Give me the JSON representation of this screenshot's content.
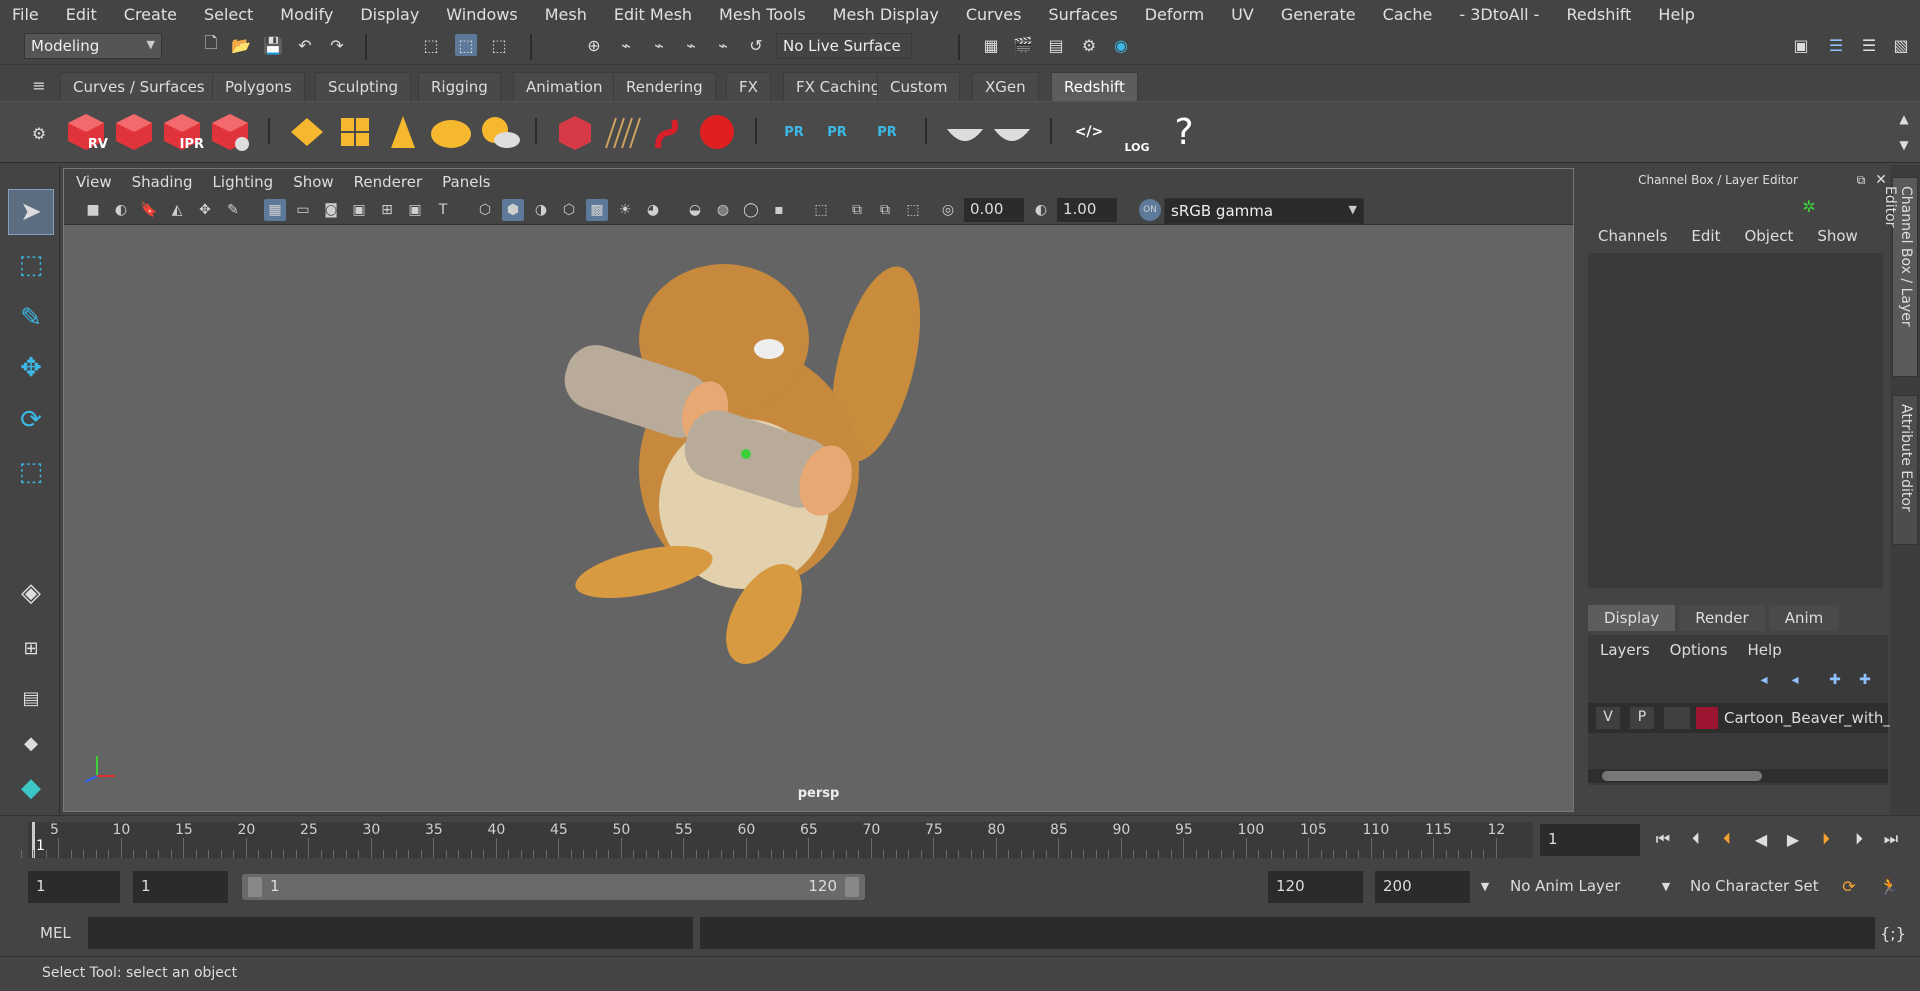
{
  "menu": [
    "File",
    "Edit",
    "Create",
    "Select",
    "Modify",
    "Display",
    "Windows",
    "Mesh",
    "Edit Mesh",
    "Mesh Tools",
    "Mesh Display",
    "Curves",
    "Surfaces",
    "Deform",
    "UV",
    "Generate",
    "Cache",
    "- 3DtoAll -",
    "Redshift",
    "Help"
  ],
  "status": {
    "workspace": "Modeling",
    "live_surface": "No Live Surface"
  },
  "shelf_tabs": [
    "Curves / Surfaces",
    "Polygons",
    "Sculpting",
    "Rigging",
    "Animation",
    "Rendering",
    "FX",
    "FX Caching",
    "Custom",
    "XGen",
    "Redshift"
  ],
  "active_shelf_tab": "Redshift",
  "shelf_labels": {
    "rv": "RV",
    "ipr": "IPR",
    "pr1": "PR",
    "pr2": "PR",
    "pr3": "PR",
    "log": "LOG"
  },
  "viewport": {
    "menu": [
      "View",
      "Shading",
      "Lighting",
      "Show",
      "Renderer",
      "Panels"
    ],
    "exposure": "0.00",
    "gamma": "1.00",
    "color_space": "sRGB gamma",
    "on_label": "ON",
    "camera": "persp"
  },
  "channel_box": {
    "title": "Channel Box / Layer Editor",
    "menu": [
      "Channels",
      "Edit",
      "Object",
      "Show"
    ],
    "layer_tabs": [
      "Display",
      "Render",
      "Anim"
    ],
    "layer_menu": [
      "Layers",
      "Options",
      "Help"
    ],
    "layer": {
      "v": "V",
      "p": "P",
      "name": "Cartoon_Beaver_with_",
      "color": "#9b1530"
    }
  },
  "side_tabs": [
    "Channel Box / Layer Editor",
    "Attribute Editor"
  ],
  "timeline": {
    "ticks": [
      "5",
      "10",
      "15",
      "20",
      "25",
      "30",
      "35",
      "40",
      "45",
      "50",
      "55",
      "60",
      "65",
      "70",
      "75",
      "80",
      "85",
      "90",
      "95",
      "100",
      "105",
      "110",
      "115",
      "12"
    ],
    "start_mark": "1",
    "current_frame": "1"
  },
  "range": {
    "start": "1",
    "anim_start": "1",
    "slider_start": "1",
    "slider_end": "120",
    "anim_end": "120",
    "end": "200",
    "anim_layer": "No Anim Layer",
    "char_set": "No Character Set"
  },
  "cmd": {
    "label": "MEL"
  },
  "help_line": "Select Tool: select an object"
}
